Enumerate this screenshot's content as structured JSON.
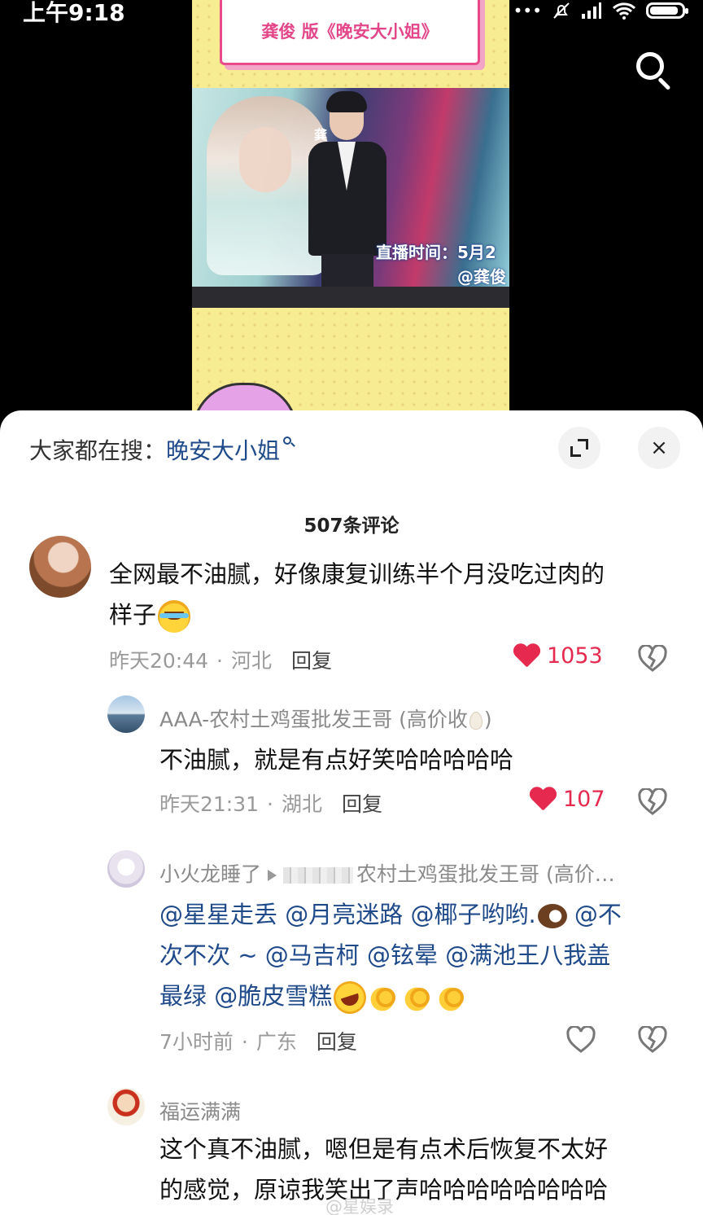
{
  "status_bar": {
    "time": "上午9:18",
    "indicators": [
      "dots-icon",
      "mute-bell-icon",
      "signal-icon",
      "wifi-icon",
      "battery-icon"
    ],
    "battery_level": 0.9
  },
  "video": {
    "title_card": "龚俊 版《晚安大小姐》",
    "logo_text": "龚",
    "caption_line1": "直播时间：5月2",
    "caption_line2": "@龚俊",
    "search_icon": "search-icon"
  },
  "sheet": {
    "hot_search_label": "大家都在搜：",
    "hot_search_keyword": "晚安大小姐",
    "expand_icon": "expand-icon",
    "close_icon": "×",
    "comment_count": "507条评论"
  },
  "comments": [
    {
      "text_line1": "全网最不油腻，好像康复训练半个月没吃过肉的",
      "text_line2": "样子",
      "time": "昨天20:44",
      "region": "河北",
      "reply": "回复",
      "likes": "1053"
    },
    {
      "user": "AAA-农村土鸡蛋批发王哥 (高价收",
      "user_tail": ")",
      "text": "不油腻，就是有点好笑哈哈哈哈哈",
      "time": "昨天21:31",
      "region": "湖北",
      "reply": "回复",
      "likes": "107"
    },
    {
      "user": "小火龙睡了",
      "reply_to": "农村土鸡蛋批发王哥 (高价…",
      "mentions_line1": [
        "@星星走丢",
        "@月亮迷路",
        "@椰子哟哟.",
        "@不"
      ],
      "line2_text": "次不次 ~ ",
      "mentions_line2": [
        "@马吉柯",
        "@铉晕",
        "@满池王八我盖"
      ],
      "line3_text": "最绿 ",
      "mentions_line3": [
        "@脆皮雪糕"
      ],
      "time": "7小时前",
      "region": "广东",
      "reply": "回复"
    },
    {
      "user": "福运满满",
      "text_line1": "这个真不油腻，嗯但是有点术后恢复不太好",
      "text_line2": "的感觉，原谅我笑出了声哈哈哈哈哈哈哈哈"
    }
  ],
  "watermark": "@星娱录",
  "colors": {
    "like_red": "#e5294f",
    "link_blue": "#1f4a8a",
    "video_yellow": "#f8ec93",
    "title_pink": "#e3478a"
  }
}
